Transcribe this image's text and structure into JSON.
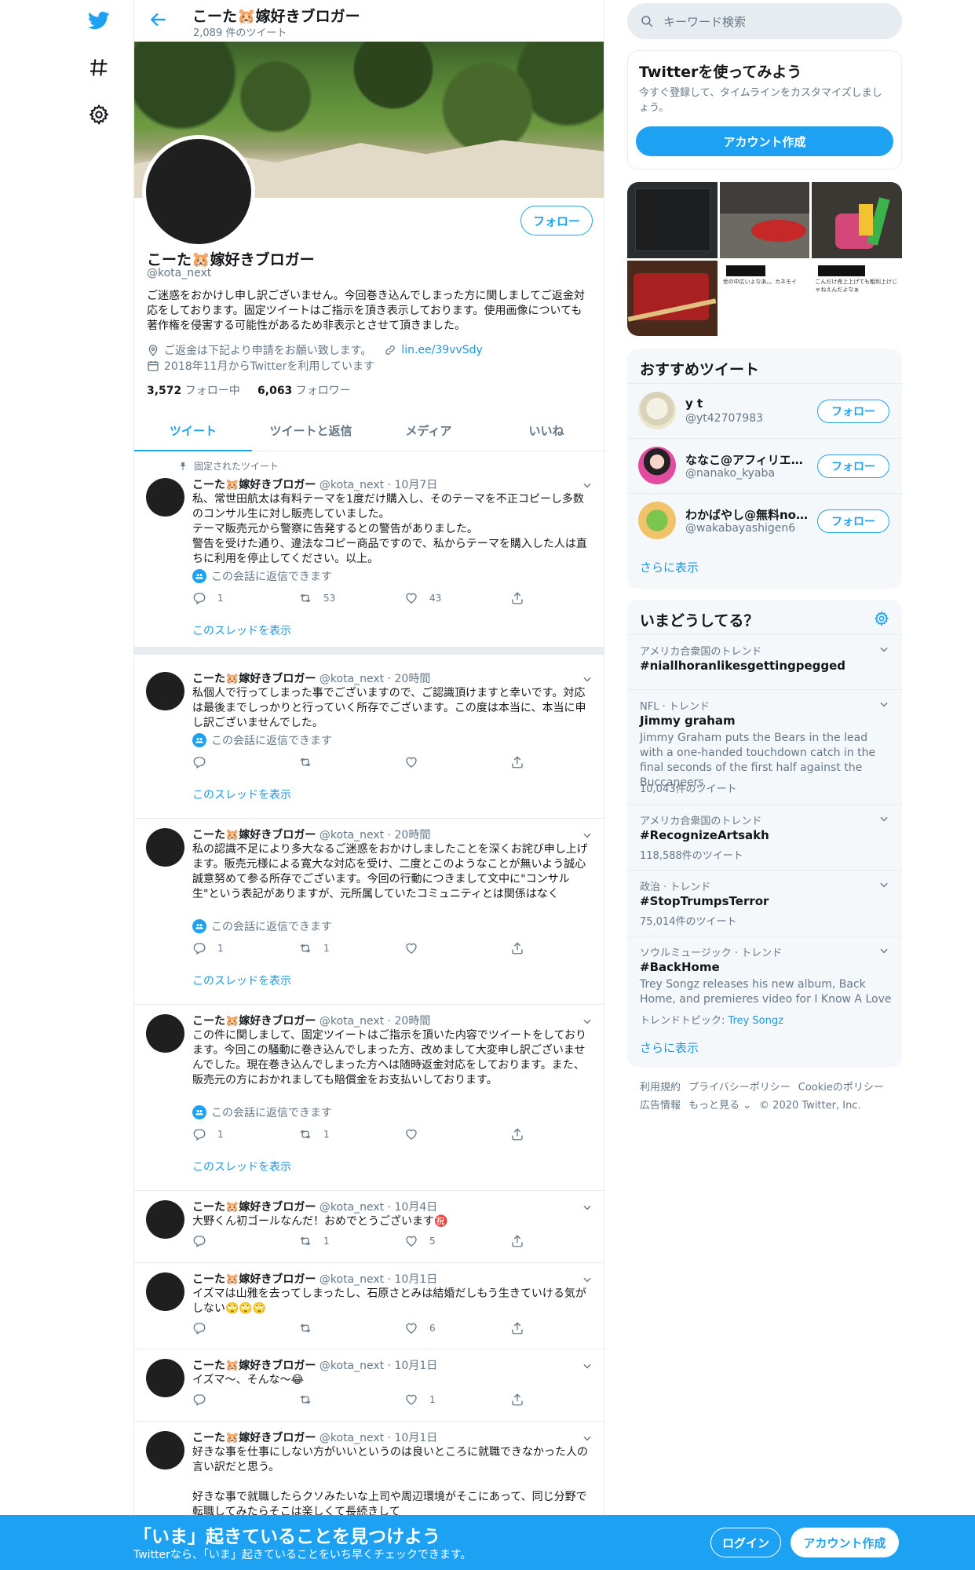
{
  "nav": {
    "twitter_icon": "twitter-bird",
    "explore_icon": "hashtag",
    "settings_icon": "gear"
  },
  "header": {
    "name": "こーた🐹嫁好きブロガー",
    "tweet_count": "2,089 件のツイート"
  },
  "profile": {
    "name": "こーた🐹嫁好きブロガー",
    "handle": "@kota_next",
    "follow_label": "フォロー",
    "bio": "ご迷惑をおかけし申し訳ございません。今回巻き込んでしまった方に関しましてご返金対応をしております。固定ツイートはご指示を頂き表示しております。使用画像についても著作権を侵害する可能性があるため非表示とさせて頂きました。",
    "location": "ご返金は下記より申請をお願い致します。",
    "url": "lin.ee/39vvSdy",
    "joined": "2018年11月からTwitterを利用しています",
    "following_count": "3,572",
    "following_label": "フォロー中",
    "followers_count": "6,063",
    "followers_label": "フォロワー"
  },
  "tabs": [
    "ツイート",
    "ツイートと返信",
    "メディア",
    "いいね"
  ],
  "pinned_label": "固定されたツイート",
  "conv_label": "この会話に返信できます",
  "thread_label": "このスレッドを表示",
  "tweets": [
    {
      "name": "こーた🐹嫁好きブロガー",
      "handle": "@kota_next",
      "time": "10月7日",
      "text": "私、常世田航太は有料テーマを1度だけ購入し、そのテーマを不正コピーし多数のコンサル生に対し販売していました。\nテーマ販売元から警察に告発するとの警告がありました。\n警告を受けた通り、違法なコピー商品ですので、私からテーマを購入した人は直ちに利用を停止してください。以上。",
      "reply": "1",
      "retweet": "53",
      "like": "43"
    },
    {
      "name": "こーた🐹嫁好きブロガー",
      "handle": "@kota_next",
      "time": "20時間",
      "text": "私個人で行ってしまった事でございますので、ご認識頂けますと幸いです。対応は最後までしっかりと行っていく所存でございます。この度は本当に、本当に申し訳ございませんでした。",
      "reply": "",
      "retweet": "",
      "like": ""
    },
    {
      "name": "こーた🐹嫁好きブロガー",
      "handle": "@kota_next",
      "time": "20時間",
      "text": "私の認識不足により多大なるご迷惑をおかけしましたことを深くお詫び申し上げます。販売元様による寛大な対応を受け、二度とこのようなことが無いよう誠心誠意努めて参る所存でございます。今回の行動につきまして文中に\"コンサル生\"という表記がありますが、元所属していたコミュニティとは関係はなく",
      "reply": "1",
      "retweet": "1",
      "like": ""
    },
    {
      "name": "こーた🐹嫁好きブロガー",
      "handle": "@kota_next",
      "time": "20時間",
      "text": "この件に関しまして、固定ツイートはご指示を頂いた内容でツイートをしております。今回この騒動に巻き込んでしまった方、改めまして大変申し訳ございませんでした。現在巻き込んでしまった方へは随時返金対応をしております。また、販売元の方におかれましても賠償金をお支払いしております。",
      "reply": "1",
      "retweet": "1",
      "like": ""
    },
    {
      "name": "こーた🐹嫁好きブロガー",
      "handle": "@kota_next",
      "time": "10月4日",
      "text": "大野くん初ゴールなんだ！おめでとうございます㊗️",
      "reply": "",
      "retweet": "1",
      "like": "5"
    },
    {
      "name": "こーた🐹嫁好きブロガー",
      "handle": "@kota_next",
      "time": "10月1日",
      "text": "イズマは山雅を去ってしまったし、石原さとみは結婚だしもう生きていける気がしない🙄🙄🙄",
      "reply": "",
      "retweet": "",
      "like": "6"
    },
    {
      "name": "こーた🐹嫁好きブロガー",
      "handle": "@kota_next",
      "time": "10月1日",
      "text": "イズマ〜、そんな〜😂",
      "reply": "",
      "retweet": "",
      "like": "1"
    },
    {
      "name": "こーた🐹嫁好きブロガー",
      "handle": "@kota_next",
      "time": "10月1日",
      "text": "好きな事を仕事にしない方がいいというのは良いところに就職できなかった人の言い訳だと思う。\n\n好きな事で就職したらクソみたいな上司や周辺環境がそこにあって、同じ分野で転職してみたらそこは楽しくて長続きして",
      "reply": "",
      "retweet": "",
      "like": ""
    }
  ],
  "search": {
    "placeholder": "キーワード検索"
  },
  "signup_card": {
    "title": "Twitterを使ってみよう",
    "desc": "今すぐ登録して、タイムラインをカスタマイズしましょう。",
    "button": "アカウント作成"
  },
  "media_tiles": {
    "t5": "世の中広いよなあ。。カネモイ",
    "t6": "こんだけ売上上げても粗利上けじゃねえんだよなぁ"
  },
  "recommend": {
    "title": "おすすめツイート",
    "users": [
      {
        "name": "y t",
        "handle": "@yt42707983",
        "btn": "フォロー"
      },
      {
        "name": "ななこ@アフィリエ…",
        "handle": "@nanako_kyaba",
        "btn": "フォロー"
      },
      {
        "name": "わかばやし@無料not…",
        "handle": "@wakabayashigen6",
        "btn": "フォロー"
      }
    ],
    "more": "さらに表示"
  },
  "trends": {
    "title": "いまどうしてる？",
    "items": [
      {
        "cat": "アメリカ合衆国のトレンド",
        "topic": "#niallhoranlikesgettingpegged",
        "desc": "",
        "count": ""
      },
      {
        "cat": "NFL · トレンド",
        "topic": "Jimmy graham",
        "desc": "Jimmy Graham puts the Bears in the lead with a one-handed touchdown catch in the final seconds of the first half against the Buccaneers",
        "count": "10,043件のツイート"
      },
      {
        "cat": "アメリカ合衆国のトレンド",
        "topic": "#RecognizeArtsakh",
        "desc": "",
        "count": "118,588件のツイート"
      },
      {
        "cat": "政治 · トレンド",
        "topic": "#StopTrumpsTerror",
        "desc": "",
        "count": "75,014件のツイート"
      },
      {
        "cat": "ソウルミュージック · トレンド",
        "topic": "#BackHome",
        "desc": "Trey Songz releases his new album, Back Home, and premieres video for I Know A Love",
        "count": "トレンドトピック: ",
        "count_link": "Trey Songz"
      }
    ],
    "more": "さらに表示"
  },
  "footer": {
    "l1": [
      "利用規約",
      "プライバシーポリシー",
      "Cookieのポリシー"
    ],
    "l2": [
      "広告情報",
      "もっと見る ⌄",
      "© 2020 Twitter, Inc."
    ]
  },
  "bottom": {
    "title": "「いま」起きていることを見つけよう",
    "sub": "Twitterなら、「いま」起きていることをいち早くチェックできます。",
    "login": "ログイン",
    "signup": "アカウント作成"
  },
  "colors": {
    "accent": "#1da1f2",
    "muted": "#657786",
    "border": "#e6ecf0"
  }
}
